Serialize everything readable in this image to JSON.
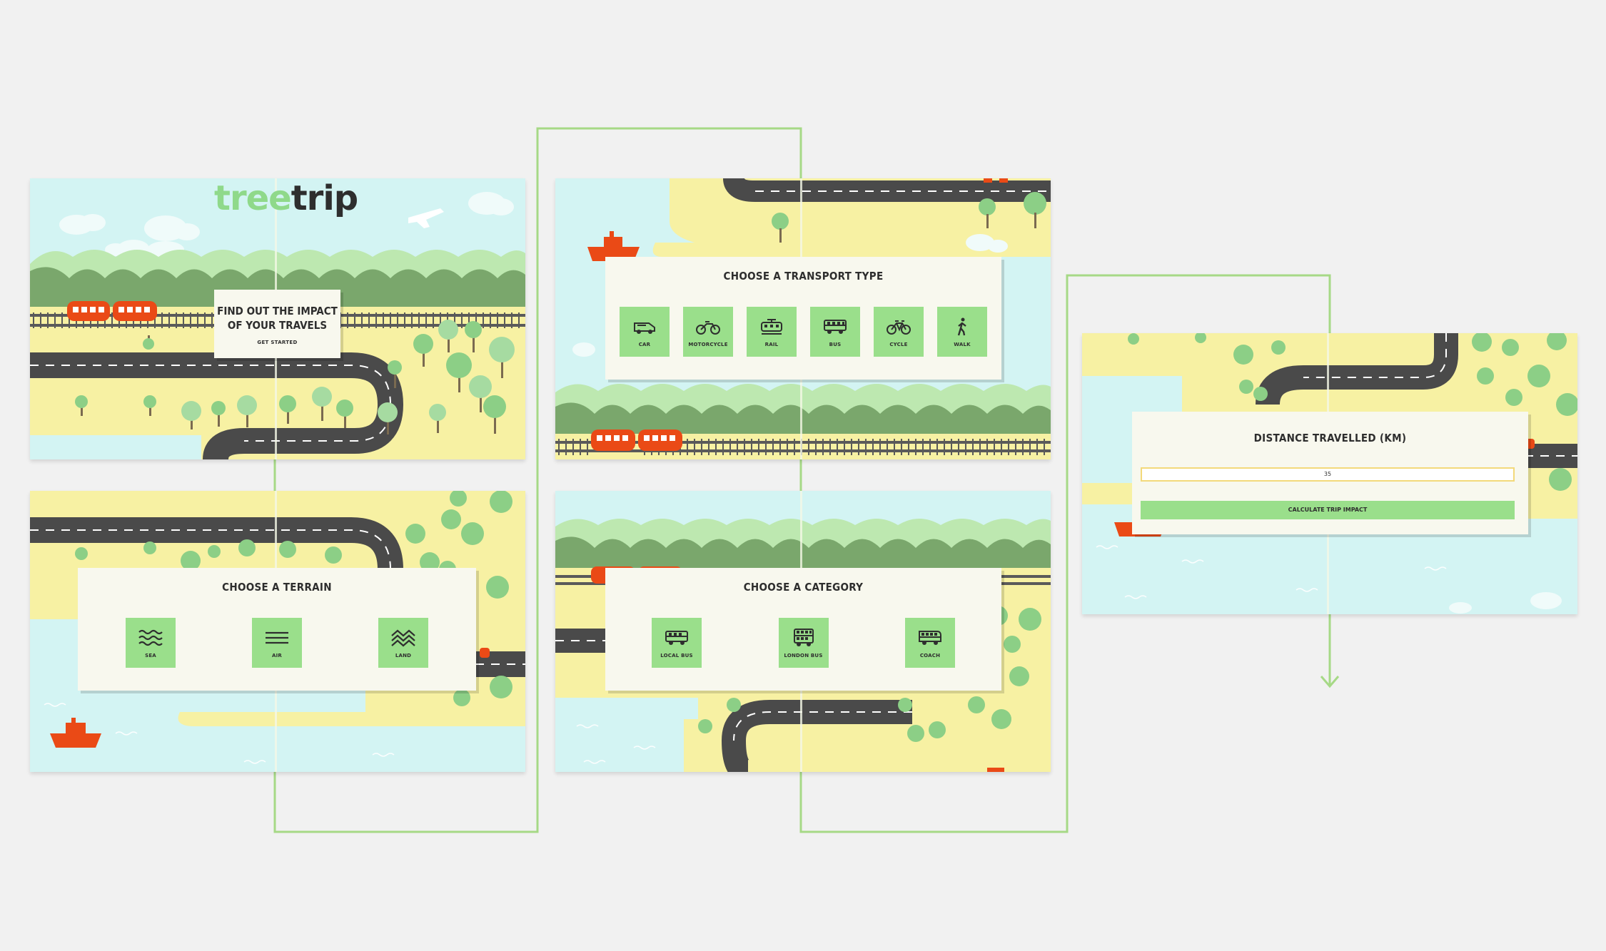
{
  "app": {
    "name_part1": "tree",
    "name_part2": "trip"
  },
  "start": {
    "title_line1": "FIND OUT THE IMPACT",
    "title_line2": "OF YOUR TRAVELS",
    "button": "GET STARTED"
  },
  "terrain": {
    "title": "CHOOSE A TERRAIN",
    "options": [
      {
        "label": "SEA",
        "icon": "waves-icon"
      },
      {
        "label": "AIR",
        "icon": "lines-icon"
      },
      {
        "label": "LAND",
        "icon": "mountains-icon"
      }
    ]
  },
  "transport": {
    "title": "CHOOSE A TRANSPORT TYPE",
    "options": [
      {
        "label": "CAR",
        "icon": "car-icon"
      },
      {
        "label": "MOTORCYCLE",
        "icon": "motorcycle-icon"
      },
      {
        "label": "RAIL",
        "icon": "train-icon"
      },
      {
        "label": "BUS",
        "icon": "bus-icon"
      },
      {
        "label": "CYCLE",
        "icon": "bicycle-icon"
      },
      {
        "label": "WALK",
        "icon": "walking-person-icon"
      }
    ]
  },
  "category": {
    "title": "CHOOSE A CATEGORY",
    "options": [
      {
        "label": "LOCAL BUS",
        "icon": "local-bus-icon"
      },
      {
        "label": "LONDON BUS",
        "icon": "double-decker-bus-icon"
      },
      {
        "label": "COACH",
        "icon": "coach-icon"
      }
    ]
  },
  "distance": {
    "title": "DISTANCE TRAVELLED (KM)",
    "input_value": "35",
    "button": "CALCULATE TRIP IMPACT"
  },
  "colors": {
    "accent_green": "#9adf8b",
    "flow_line": "#a6d986",
    "sky": "#d3f4f3",
    "sand": "#f7f1a3",
    "road": "#4a4a4a",
    "vehicle": "#ea4a16"
  }
}
